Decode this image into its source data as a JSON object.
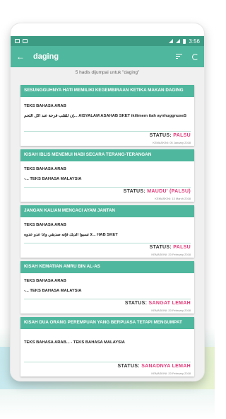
{
  "status_bar": {
    "time": "3:56"
  },
  "app_bar": {
    "back_icon": "←",
    "title": "daging",
    "sort_icon": "sort-icon",
    "refresh_icon": "refresh-icon"
  },
  "results": {
    "text": "5 hadis dijumpai untuk \"daging\""
  },
  "cards": [
    {
      "title": "SESUNGGUHNYA HATI MEMILIKI KEGEMBIRAAN KETIKA MAKAN DAGING",
      "line1": "TEKS BAHASA ARAB",
      "line2": "إن للقلب فرحة عند أكل اللحم...   AISYALAM ASAHAB SKET  ikilimem itah aynhuggnuseS",
      "status_label": "STATUS:",
      "status_value": "PALSU",
      "date": "KEMASKINI: 05 January 2018"
    },
    {
      "title": "KISAH IBLIS MENEMUI NABI SECARA TERANG-TERANGAN",
      "line1": "TEKS BAHASA ARAB",
      "line2": "-...  TEKS BAHASA MALAYSIA",
      "status_label": "STATUS:",
      "status_value": "MAUDU' (PALSU)",
      "date": "KEMASKINI: 13 March 2018"
    },
    {
      "title": "JANGAN KALIAN MENCACI AYAM JANTAN",
      "line1": "TEKS BAHASA ARAB",
      "line2": "لا تسبوا الديك فإنه صديقي وأنا عدو عدوه... HAB SKET",
      "status_label": "STATUS:",
      "status_value": "PALSU",
      "date": "KEMASKINI: 20 February 2018"
    },
    {
      "title": "KISAH KEMATIAN AMRU BIN AL-AS",
      "line1": "TEKS BAHASA ARAB",
      "line2": "-...  TEKS BAHASA MALAYSIA",
      "status_label": "STATUS:",
      "status_value": "SANGAT LEMAH",
      "date": "KEMASKINI: 20 February 2018"
    },
    {
      "title": "KISAH DUA ORANG PEREMPUAN YANG BERPUASA TETAPI MENGUMPAT",
      "line1": "TEKS BAHASA ARAB...  -  TEKS BAHASA MALAYSIA",
      "line2": "",
      "status_label": "STATUS:",
      "status_value": "SANADNYA LEMAH",
      "date": "KEMASKINI: 20 February 2018"
    }
  ]
}
